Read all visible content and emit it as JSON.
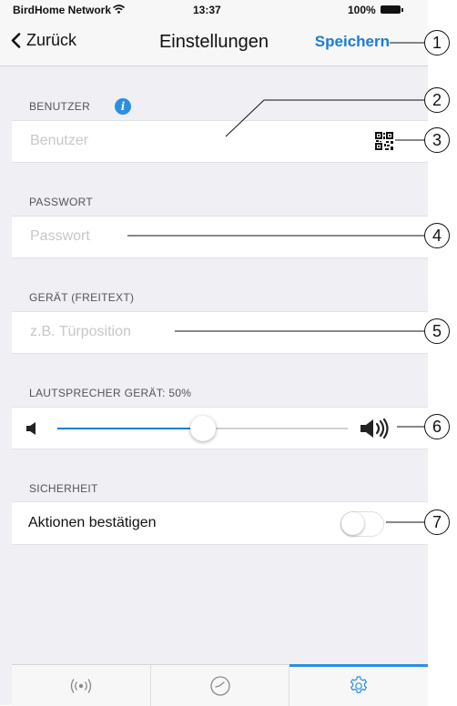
{
  "status_bar": {
    "carrier": "BirdHome Network",
    "time": "13:37",
    "battery": "100%"
  },
  "nav": {
    "back_label": "Zurück",
    "title": "Einstellungen",
    "save_label": "Speichern"
  },
  "sections": {
    "user": {
      "label": "BENUTZER",
      "placeholder": "Benutzer",
      "value": ""
    },
    "password": {
      "label": "PASSWORT",
      "placeholder": "Passwort",
      "value": ""
    },
    "device": {
      "label": "GERÄT (FREITEXT)",
      "placeholder": "z.B. Türposition",
      "value": ""
    },
    "speaker": {
      "label": "LAUTSPRECHER GERÄT: 50%",
      "volume_percent": 50
    },
    "security": {
      "label": "SICHERHEIT",
      "confirm_actions_label": "Aktionen bestätigen",
      "confirm_actions_on": false
    }
  },
  "tabs": [
    {
      "icon": "live-signal-icon",
      "active": false
    },
    {
      "icon": "history-clock-icon",
      "active": false
    },
    {
      "icon": "settings-gear-icon",
      "active": true
    }
  ],
  "callouts": [
    "1",
    "2",
    "3",
    "4",
    "5",
    "6",
    "7"
  ],
  "colors": {
    "accent": "#1a7cd6",
    "background": "#efeff4"
  }
}
